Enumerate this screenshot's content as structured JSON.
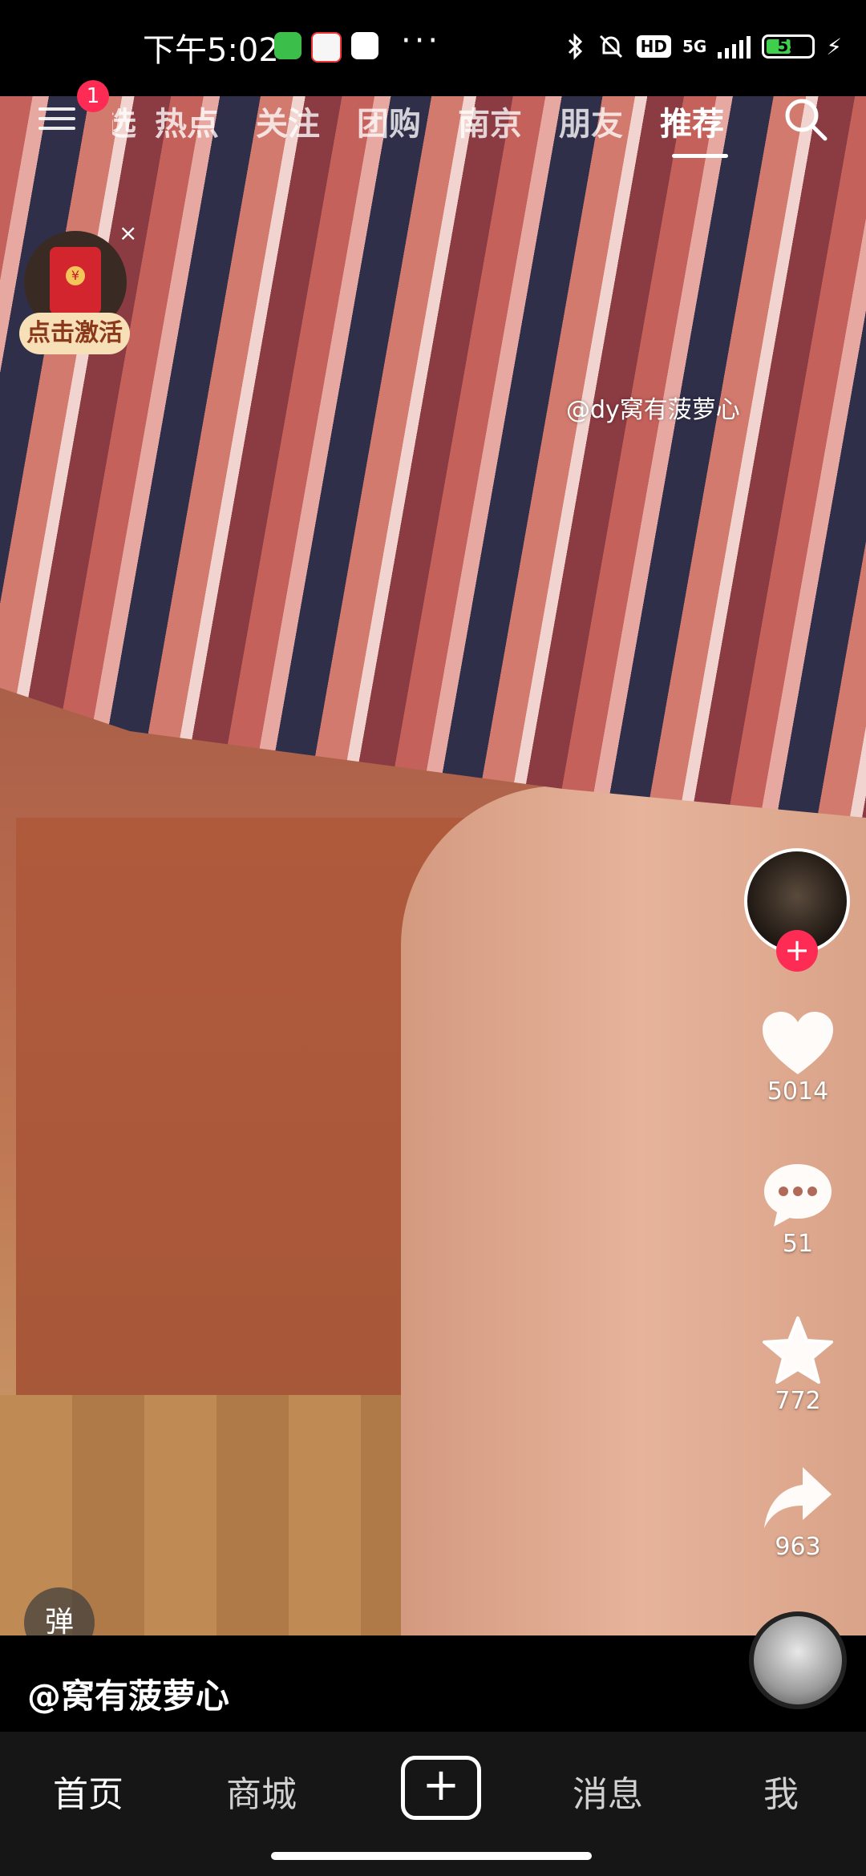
{
  "status_bar": {
    "time": "下午5:02",
    "app_icons": [
      "green-app-icon",
      "58-app-icon",
      "cloud-app-icon"
    ],
    "more": "···",
    "network": "5G",
    "hd": "HD",
    "battery": "55",
    "battery_level": 0.55,
    "battery_color": "#3ecf4c"
  },
  "top_nav": {
    "menu_badge": "1",
    "tabs": [
      "选",
      "热点",
      "关注",
      "团购",
      "南京",
      "朋友",
      "推荐"
    ],
    "active_tab": "推荐"
  },
  "red_packet": {
    "label": "点击激活",
    "close": "×"
  },
  "video": {
    "watermark": "@dy窝有菠萝心"
  },
  "rail": {
    "likes": "5014",
    "comments": "51",
    "favorites": "772",
    "shares": "963",
    "follow": "+"
  },
  "danmu": "弹",
  "author": "@窝有菠萝心",
  "bottom_nav": {
    "home": "首页",
    "mall": "商城",
    "create": "+",
    "messages": "消息",
    "me": "我"
  },
  "colors": {
    "accent": "#fe2c55",
    "nav_background": "#161616"
  }
}
